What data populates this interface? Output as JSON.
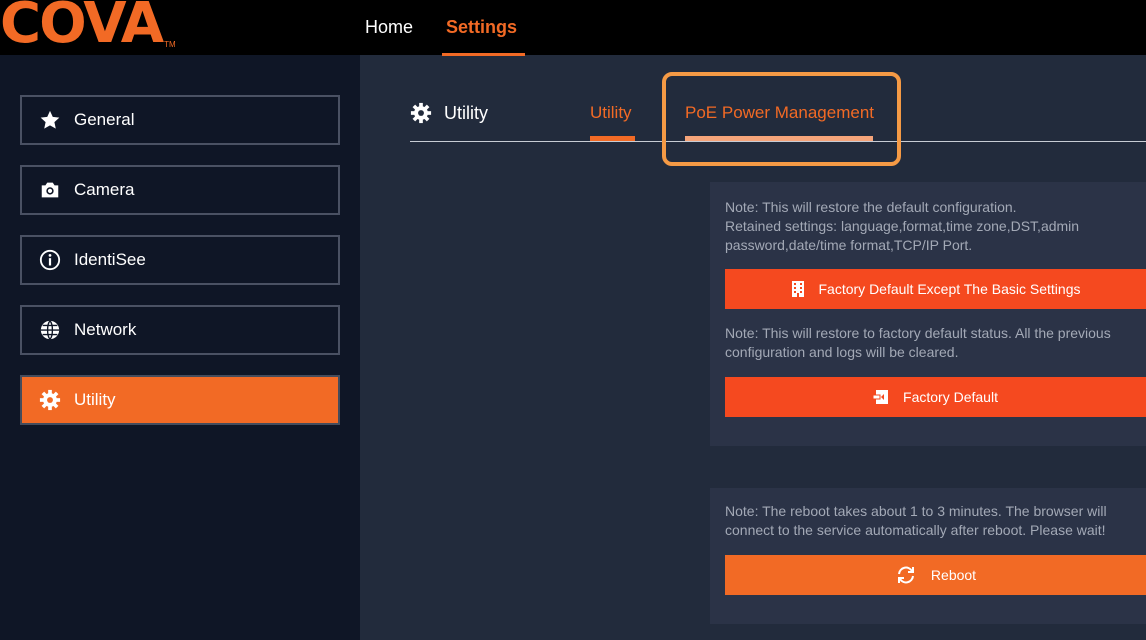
{
  "brand": {
    "logo_text": "COVA",
    "trademark": "TM",
    "color": "#f26a25"
  },
  "nav": {
    "home": "Home",
    "settings": "Settings"
  },
  "sidebar": {
    "items": [
      {
        "label": "General",
        "icon": "star-icon"
      },
      {
        "label": "Camera",
        "icon": "camera-icon"
      },
      {
        "label": "IdentiSee",
        "icon": "info-icon"
      },
      {
        "label": "Network",
        "icon": "globe-icon"
      },
      {
        "label": "Utility",
        "icon": "gear-icon",
        "active": true
      }
    ]
  },
  "main": {
    "title": "Utility",
    "tabs": [
      {
        "label": "Utility"
      },
      {
        "label": "PoE Power Management"
      }
    ]
  },
  "panel1": {
    "note1_lines": [
      "Note: This will restore the default configuration.",
      "Retained settings: language,format,time zone,DST,admin",
      "password,date/time format,TCP/IP Port."
    ],
    "button1": "Factory Default Except The Basic Settings",
    "note2_lines": [
      "Note: This will restore to factory default status. All the previous",
      "configuration and logs will be cleared."
    ],
    "button2": "Factory Default"
  },
  "panel2": {
    "note_lines": [
      "Note: The reboot takes about 1 to 3 minutes. The browser will",
      "connect to the service automatically after reboot. Please wait!"
    ],
    "button": "Reboot"
  },
  "colors": {
    "accent": "#f26a25",
    "danger_button": "#f5491f",
    "sidebar_bg": "#0f1626",
    "main_bg": "#222b3c",
    "panel_bg": "#2b3347"
  }
}
